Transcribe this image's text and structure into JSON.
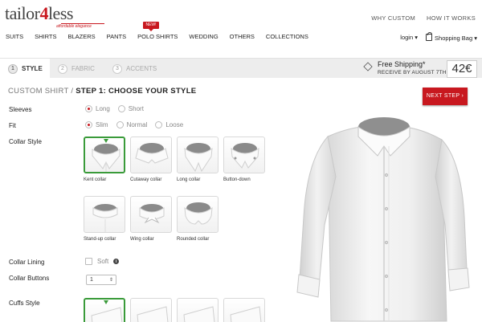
{
  "brand": {
    "name_a": "tailor",
    "name_b": "4",
    "name_c": "less",
    "tagline": "affordable elegance"
  },
  "toplinks": [
    "WHY CUSTOM",
    "HOW IT WORKS"
  ],
  "nav": [
    "SUITS",
    "SHIRTS",
    "BLAZERS",
    "PANTS",
    "POLO SHIRTS",
    "WEDDING",
    "OTHERS",
    "COLLECTIONS"
  ],
  "new_badge": "NEW!",
  "user": {
    "login": "login",
    "bag": "Shopping Bag"
  },
  "steps": [
    {
      "num": "1",
      "label": "STYLE",
      "active": true
    },
    {
      "num": "2",
      "label": "FABRIC",
      "active": false
    },
    {
      "num": "3",
      "label": "ACCENTS",
      "active": false
    }
  ],
  "shipping": {
    "title": "Free Shipping*",
    "sub": "RECEIVE BY AUGUST 7TH"
  },
  "price": "42€",
  "breadcrumb": {
    "part1": "CUSTOM SHIRT",
    "sep": " / ",
    "part2": "STEP 1: CHOOSE YOUR STYLE"
  },
  "next_button": "NEXT STEP ›",
  "options": {
    "sleeves": {
      "label": "Sleeves",
      "choices": [
        "Long",
        "Short"
      ],
      "selected": "Long"
    },
    "fit": {
      "label": "Fit",
      "choices": [
        "Slim",
        "Normal",
        "Loose"
      ],
      "selected": "Slim"
    },
    "collar_style": {
      "label": "Collar Style",
      "choices": [
        "Kent collar",
        "Cutaway collar",
        "Long collar",
        "Button-down",
        "Stand-up collar",
        "Wing collar",
        "Rounded collar"
      ],
      "selected": "Kent collar"
    },
    "collar_lining": {
      "label": "Collar Lining",
      "checkbox": "Soft"
    },
    "collar_buttons": {
      "label": "Collar Buttons",
      "value": "1"
    },
    "cuffs_style": {
      "label": "Cuffs Style"
    }
  },
  "colors": {
    "accent": "#c8181f",
    "selected": "#3a9b3a"
  }
}
